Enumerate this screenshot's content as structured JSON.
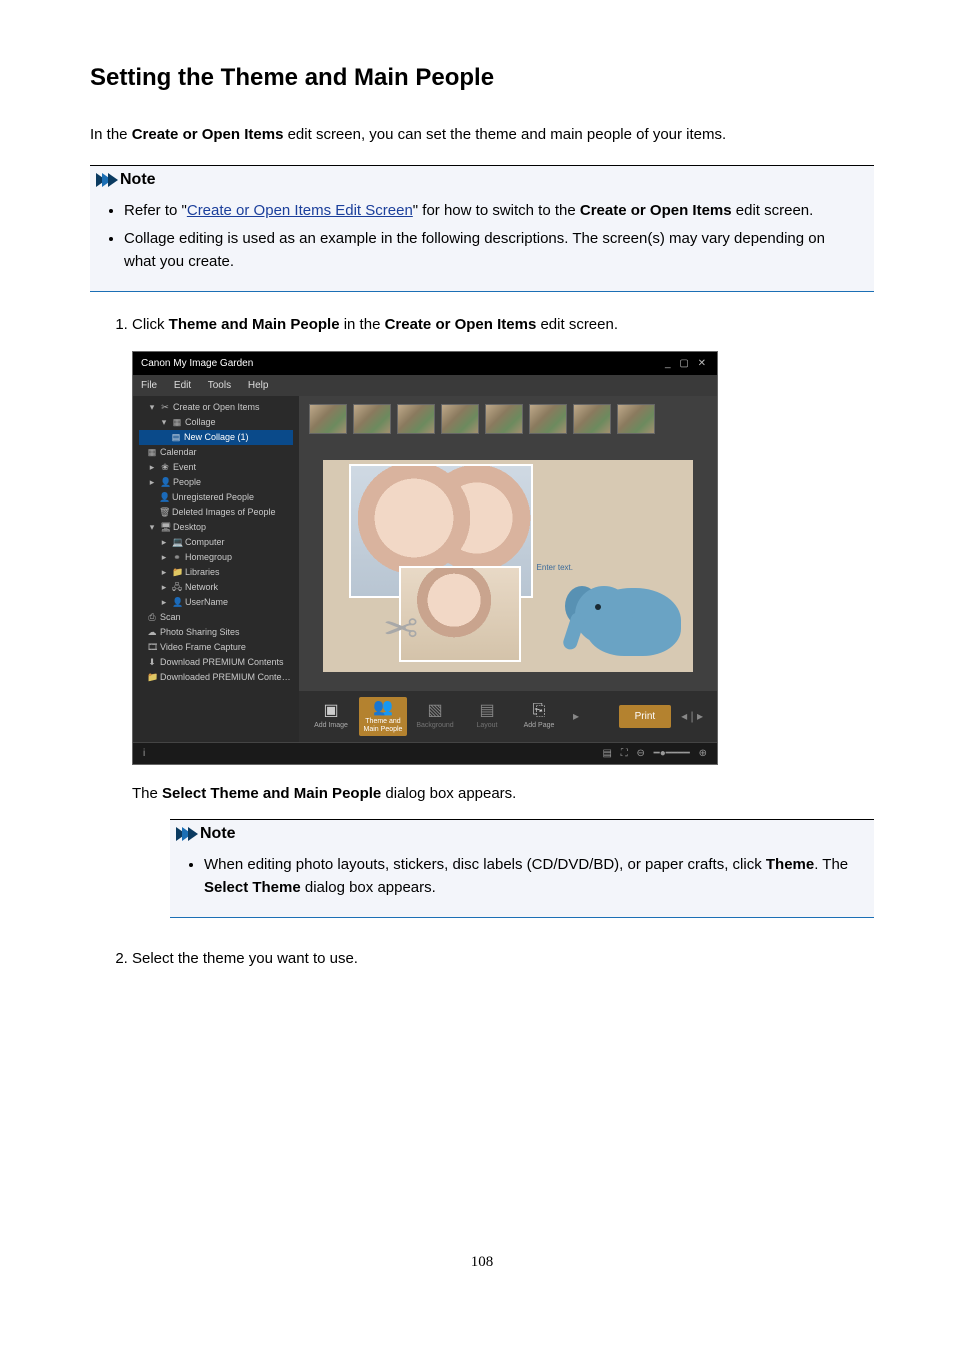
{
  "title": "Setting the Theme and Main People",
  "intro_pre": "In the ",
  "intro_bold": "Create or Open Items",
  "intro_post": " edit screen, you can set the theme and main people of your items.",
  "note_label": "Note",
  "note1": {
    "refer_pre": "Refer to \"",
    "link": "Create or Open Items Edit Screen",
    "refer_mid": "\" for how to switch to the ",
    "refer_bold": "Create or Open Items",
    "refer_post": " edit screen.",
    "bullet2": "Collage editing is used as an example in the following descriptions. The screen(s) may vary depending on what you create."
  },
  "step1": {
    "pre": "Click ",
    "b1": "Theme and Main People",
    "mid": " in the ",
    "b2": "Create or Open Items",
    "post": " edit screen."
  },
  "app": {
    "title": "Canon My Image Garden",
    "menu": {
      "file": "File",
      "edit": "Edit",
      "tools": "Tools",
      "help": "Help"
    },
    "tree": {
      "create": "Create or Open Items",
      "collage": "Collage",
      "newcollage": "New Collage (1)",
      "calendar": "Calendar",
      "event": "Event",
      "people": "People",
      "unreg": "Unregistered People",
      "deleted": "Deleted Images of People",
      "desktop": "Desktop",
      "computer": "Computer",
      "homegroup": "Homegroup",
      "libraries": "Libraries",
      "network": "Network",
      "username": "UserName",
      "scan": "Scan",
      "photoshare": "Photo Sharing Sites",
      "videoframe": "Video Frame Capture",
      "dlprem": "Download PREMIUM Contents",
      "dledprem": "Downloaded PREMIUM Contents"
    },
    "canvas": {
      "enter_text": "Enter text.",
      "sub_text": ""
    },
    "toolbar": {
      "addimage": "Add Image",
      "theme": "Theme and Main People",
      "background": "Background",
      "layout": "Layout",
      "addpage": "Add Page",
      "print": "Print"
    },
    "status_info": "i"
  },
  "caption": {
    "pre": "The ",
    "bold": "Select Theme and Main People",
    "post": " dialog box appears."
  },
  "note2": {
    "pre": "When editing photo layouts, stickers, disc labels (CD/DVD/BD), or paper crafts, click ",
    "b1": "Theme",
    "mid": ". The ",
    "b2": "Select Theme",
    "post": " dialog box appears."
  },
  "step2": "Select the theme you want to use.",
  "page_number": "108"
}
